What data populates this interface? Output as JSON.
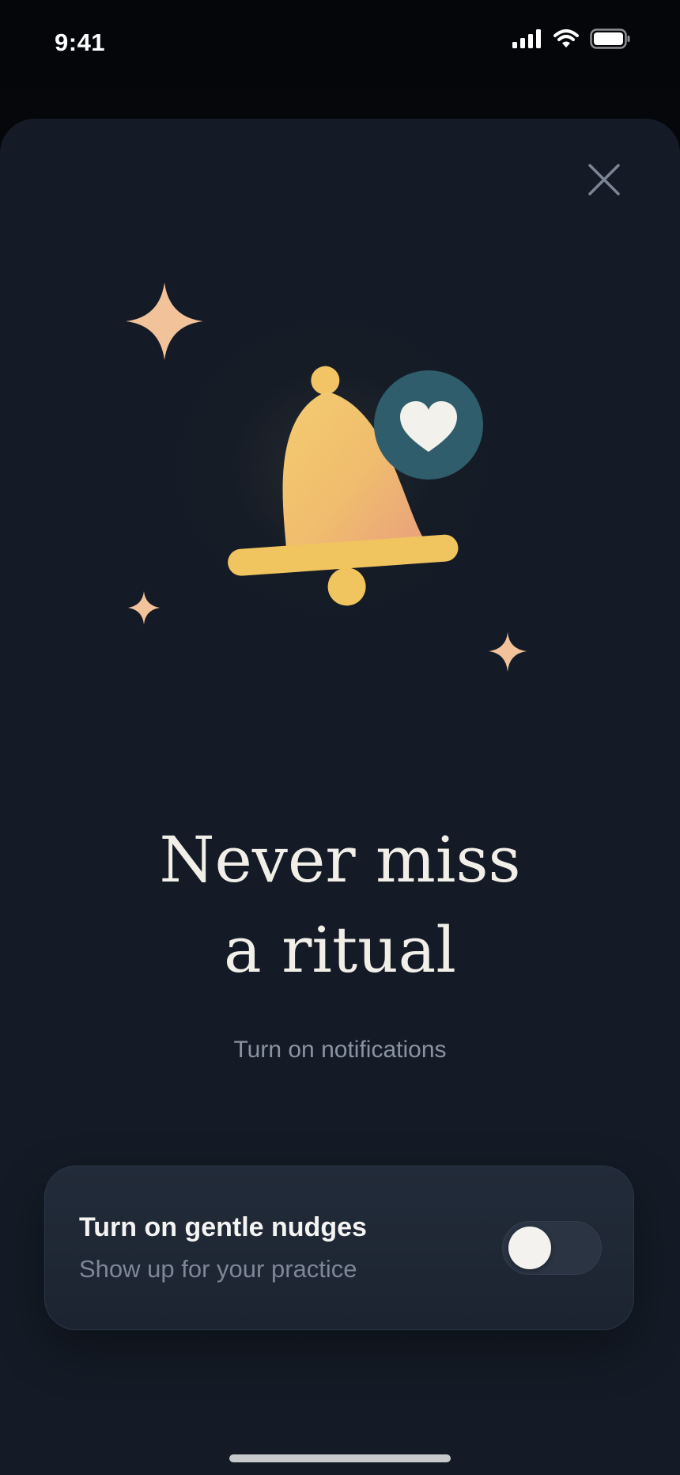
{
  "status_bar": {
    "time": "9:41",
    "icons": [
      "signal-icon",
      "wifi-icon",
      "battery-icon"
    ]
  },
  "sheet": {
    "close_icon": "close-icon",
    "illustration_icons": [
      "bell-icon",
      "heart-icon",
      "sparkle-icon"
    ],
    "headline_line1": "Never miss",
    "headline_line2": "a ritual",
    "subtitle": "Turn on notifications"
  },
  "nudges_card": {
    "title": "Turn on gentle nudges",
    "subtitle": "Show up for your practice",
    "toggle_on": false
  },
  "colors": {
    "background": "#141b26",
    "bell_gold": "#f0c661",
    "heart_badge": "#2f5d6b",
    "sparkle": "#f2c29a",
    "headline": "#f2efe8",
    "muted_text": "#8a93a2"
  }
}
